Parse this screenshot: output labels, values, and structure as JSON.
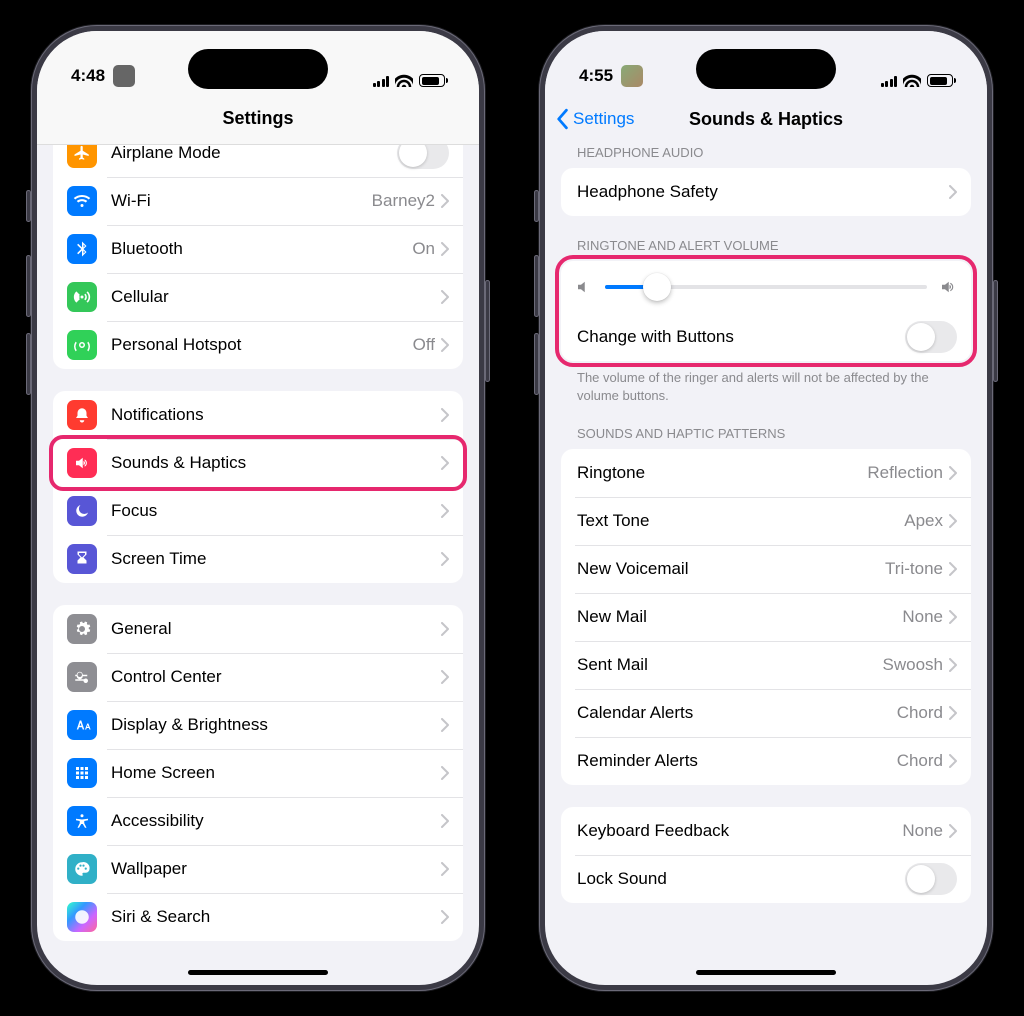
{
  "phoneLeft": {
    "time": "4:48",
    "title": "Settings",
    "groups": [
      {
        "rows": [
          {
            "icon": "airplane",
            "iconClass": "bg-orange",
            "label": "Airplane Mode",
            "type": "toggle",
            "on": false
          },
          {
            "icon": "wifi",
            "iconClass": "bg-blue",
            "label": "Wi-Fi",
            "type": "nav",
            "detail": "Barney2"
          },
          {
            "icon": "bt",
            "iconClass": "bg-bt",
            "label": "Bluetooth",
            "type": "nav",
            "detail": "On"
          },
          {
            "icon": "cell",
            "iconClass": "bg-green",
            "label": "Cellular",
            "type": "nav"
          },
          {
            "icon": "hotspot",
            "iconClass": "bg-green2",
            "label": "Personal Hotspot",
            "type": "nav",
            "detail": "Off"
          }
        ]
      },
      {
        "rows": [
          {
            "icon": "bell",
            "iconClass": "bg-red",
            "label": "Notifications",
            "type": "nav"
          },
          {
            "icon": "sound",
            "iconClass": "bg-pink",
            "label": "Sounds & Haptics",
            "type": "nav",
            "highlight": true
          },
          {
            "icon": "moon",
            "iconClass": "bg-indigo",
            "label": "Focus",
            "type": "nav"
          },
          {
            "icon": "hour",
            "iconClass": "bg-indigo",
            "label": "Screen Time",
            "type": "nav"
          }
        ]
      },
      {
        "rows": [
          {
            "icon": "gear",
            "iconClass": "bg-gray",
            "label": "General",
            "type": "nav"
          },
          {
            "icon": "cc",
            "iconClass": "bg-gray2",
            "label": "Control Center",
            "type": "nav"
          },
          {
            "icon": "aa",
            "iconClass": "bg-blue",
            "label": "Display & Brightness",
            "type": "nav"
          },
          {
            "icon": "grid",
            "iconClass": "bg-blue",
            "label": "Home Screen",
            "type": "nav"
          },
          {
            "icon": "access",
            "iconClass": "bg-blue",
            "label": "Accessibility",
            "type": "nav"
          },
          {
            "icon": "wall",
            "iconClass": "bg-teal",
            "label": "Wallpaper",
            "type": "nav"
          },
          {
            "icon": "siri",
            "iconClass": "bg-siri",
            "label": "Siri & Search",
            "type": "nav"
          }
        ]
      }
    ]
  },
  "phoneRight": {
    "time": "4:55",
    "back": "Settings",
    "title": "Sounds & Haptics",
    "sections": [
      {
        "header": "HEADPHONE AUDIO",
        "rows": [
          {
            "label": "Headphone Safety",
            "type": "nav"
          }
        ]
      },
      {
        "header": "RINGTONE AND ALERT VOLUME",
        "highlight": true,
        "slider": {
          "value": 16
        },
        "rows": [
          {
            "label": "Change with Buttons",
            "type": "toggle",
            "on": false
          }
        ],
        "footer": "The volume of the ringer and alerts will not be affected by the volume buttons."
      },
      {
        "header": "SOUNDS AND HAPTIC PATTERNS",
        "rows": [
          {
            "label": "Ringtone",
            "type": "nav",
            "detail": "Reflection"
          },
          {
            "label": "Text Tone",
            "type": "nav",
            "detail": "Apex"
          },
          {
            "label": "New Voicemail",
            "type": "nav",
            "detail": "Tri-tone"
          },
          {
            "label": "New Mail",
            "type": "nav",
            "detail": "None"
          },
          {
            "label": "Sent Mail",
            "type": "nav",
            "detail": "Swoosh"
          },
          {
            "label": "Calendar Alerts",
            "type": "nav",
            "detail": "Chord"
          },
          {
            "label": "Reminder Alerts",
            "type": "nav",
            "detail": "Chord"
          }
        ]
      },
      {
        "rows": [
          {
            "label": "Keyboard Feedback",
            "type": "nav",
            "detail": "None"
          },
          {
            "label": "Lock Sound",
            "type": "toggle",
            "on": false
          }
        ]
      }
    ]
  }
}
